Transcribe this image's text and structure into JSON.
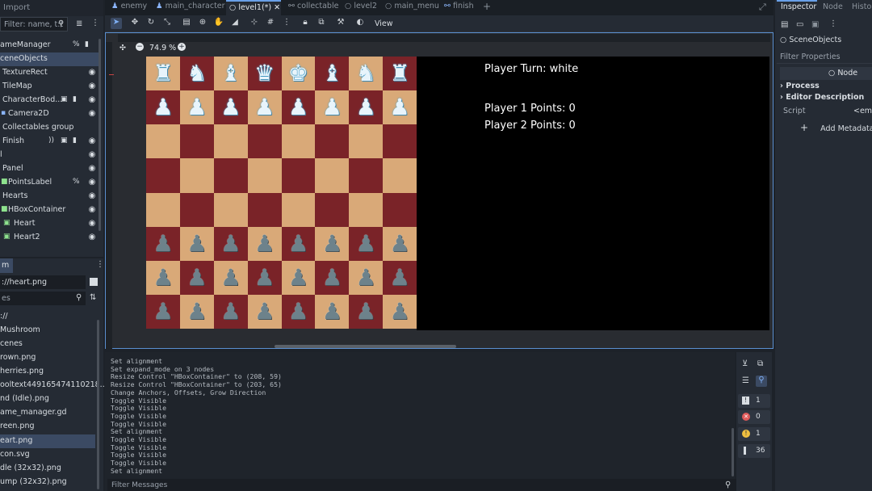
{
  "scene_dock": {
    "title": "Import",
    "filter_placeholder": "Filter: name, t:t",
    "items": [
      {
        "label": "ameManager"
      },
      {
        "label": "ceneObjects"
      },
      {
        "label": "TextureRect"
      },
      {
        "label": "TileMap"
      },
      {
        "label": "CharacterBod..."
      },
      {
        "label": "Camera2D"
      },
      {
        "label": "Collectables group"
      },
      {
        "label": "Finish"
      },
      {
        "label": "l"
      },
      {
        "label": "Panel"
      },
      {
        "label": "PointsLabel"
      },
      {
        "label": "Hearts"
      },
      {
        "label": "HBoxContainer"
      },
      {
        "label": "Heart"
      },
      {
        "label": "Heart2"
      }
    ]
  },
  "filesystem": {
    "tab": "m",
    "path": "://heart.png",
    "filter_placeholder": "es",
    "items": [
      {
        "label": "://"
      },
      {
        "label": "Mushroom"
      },
      {
        "label": "cenes"
      },
      {
        "label": "rown.png"
      },
      {
        "label": "herries.png"
      },
      {
        "label": "ooltext449165474110218..."
      },
      {
        "label": "nd (Idle).png"
      },
      {
        "label": "ame_manager.gd"
      },
      {
        "label": "reen.png"
      },
      {
        "label": "eart.png"
      },
      {
        "label": "con.svg"
      },
      {
        "label": "dle (32x32).png"
      },
      {
        "label": "ump (32x32).png"
      }
    ]
  },
  "tabs": [
    {
      "label": "enemy"
    },
    {
      "label": "main_character"
    },
    {
      "label": "level1(*)"
    },
    {
      "label": "collectable"
    },
    {
      "label": "level2"
    },
    {
      "label": "main_menu"
    },
    {
      "label": "finish"
    }
  ],
  "toolbar": {
    "view_label": "View"
  },
  "viewport": {
    "zoom": "74.9 %"
  },
  "game": {
    "turn_text": "Player Turn: white",
    "p1_text": "Player 1 Points: 0",
    "p2_text": "Player 2 Points: 0"
  },
  "board": {
    "white_back": [
      "♜",
      "♞",
      "♝",
      "♛",
      "♚",
      "♝",
      "♞",
      "♜"
    ],
    "white_pawns": [
      "♟",
      "♟",
      "♟",
      "♟",
      "♟",
      "♟",
      "♟",
      "♟"
    ],
    "black_rows_glyph": "♟"
  },
  "output": {
    "lines": [
      "Set alignment",
      "Set expand_mode on 3 nodes",
      "Resize Control \"HBoxContainer\" to (208, 59)",
      "Resize Control \"HBoxContainer\" to (203, 65)",
      "Change Anchors, Offsets, Grow Direction",
      "Toggle Visible",
      "Toggle Visible",
      "Toggle Visible",
      "Toggle Visible",
      "Set alignment",
      "Toggle Visible",
      "Toggle Visible",
      "Toggle Visible",
      "Toggle Visible",
      "Set alignment"
    ],
    "filter_placeholder": "Filter Messages",
    "counts": {
      "log": "1",
      "errors": "0",
      "warnings": "1",
      "messages": "36"
    }
  },
  "inspector": {
    "tabs": [
      "Inspector",
      "Node",
      "Histor"
    ],
    "node_name": "SceneObjects",
    "filter_placeholder": "Filter Properties",
    "class_label": "Node",
    "section_process": "Process",
    "section_editor_desc": "Editor Description",
    "script_label": "Script",
    "script_value": "<emp",
    "add_metadata": "Add Metadata"
  },
  "colors": {
    "accent": "#6aa0e8",
    "light_square": "#d9a978",
    "dark_square": "#7a2328"
  }
}
